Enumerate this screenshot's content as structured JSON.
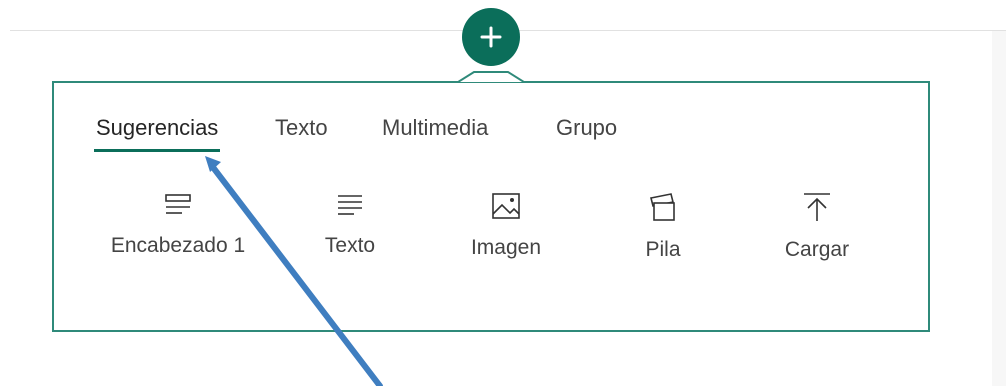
{
  "add_button": {
    "icon": "plus-icon",
    "color": "#0b6e5a"
  },
  "panel": {
    "border_color": "#2f8a7a"
  },
  "tabs": [
    {
      "label": "Sugerencias",
      "selected": true
    },
    {
      "label": "Texto",
      "selected": false
    },
    {
      "label": "Multimedia",
      "selected": false
    },
    {
      "label": "Grupo",
      "selected": false
    }
  ],
  "items": [
    {
      "label": "Encabezado 1",
      "icon": "heading-icon"
    },
    {
      "label": "Texto",
      "icon": "text-icon"
    },
    {
      "label": "Imagen",
      "icon": "image-icon"
    },
    {
      "label": "Pila",
      "icon": "stack-icon"
    },
    {
      "label": "Cargar",
      "icon": "upload-icon"
    }
  ],
  "annotation": {
    "type": "arrow",
    "color": "#3f7ec0"
  }
}
